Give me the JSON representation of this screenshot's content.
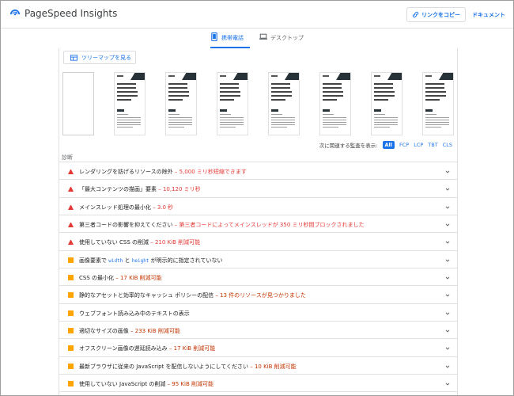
{
  "header": {
    "brand": "PageSpeed Insights",
    "copy_link": "リンクをコピー",
    "docs": "ドキュメント"
  },
  "tabs": {
    "mobile": "携帯電話",
    "desktop": "デスクトップ"
  },
  "treemap": {
    "label": "ツリーマップを見る"
  },
  "filter": {
    "label": "次に関連する監査を表示:",
    "options": [
      "All",
      "FCP",
      "LCP",
      "TBT",
      "CLS"
    ],
    "selected": "All"
  },
  "diagnostics": {
    "title": "診断",
    "items": [
      {
        "severity": "fail",
        "title": "レンダリングを妨げるリソースの除外",
        "savings": "5,000 ミリ秒短縮できます"
      },
      {
        "severity": "fail",
        "title": "「最大コンテンツの描画」要素",
        "savings": "10,120 ミリ秒"
      },
      {
        "severity": "fail",
        "title": "メインスレッド処理の最小化",
        "savings": "3.0 秒"
      },
      {
        "severity": "fail",
        "title": "第三者コードの影響を抑えてください",
        "savings": "第三者コードによってメインスレッドが 350 ミリ秒間ブロックされました"
      },
      {
        "severity": "fail",
        "title": "使用していない CSS の削減",
        "savings": "210 KiB 削減可能"
      },
      {
        "severity": "avg",
        "title_pre": "画像要素で ",
        "code1": "width",
        "title_mid": " と ",
        "code2": "height",
        "title_post": " が明示的に指定されていない",
        "savings": ""
      },
      {
        "severity": "avg",
        "title": "CSS の最小化",
        "savings": "17 KiB 削減可能"
      },
      {
        "severity": "avg",
        "title": "静的なアセットと効率的なキャッシュ ポリシーの配信",
        "savings": "13 件のリソースが見つかりました"
      },
      {
        "severity": "avg",
        "title": "ウェブフォント読み込み中のテキストの表示",
        "savings": ""
      },
      {
        "severity": "avg",
        "title": "適切なサイズの画像",
        "savings": "233 KiB 削減可能"
      },
      {
        "severity": "avg",
        "title": "オフスクリーン画像の遅延読み込み",
        "savings": "17 KiB 削減可能"
      },
      {
        "severity": "avg",
        "title": "最新ブラウザに従来の JavaScript を配信しないようにしてください",
        "savings": "10 KiB 削減可能"
      },
      {
        "severity": "avg",
        "title": "使用していない JavaScript の削減",
        "savings": "95 KiB 削減可能"
      }
    ]
  },
  "colors": {
    "accent": "#1a73e8",
    "fail": "#e53935",
    "average": "#ffa400"
  }
}
